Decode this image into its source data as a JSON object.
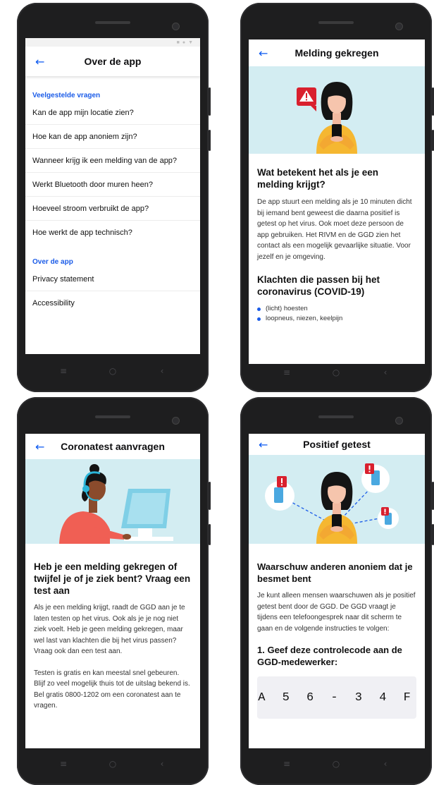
{
  "colors": {
    "accent": "#1b5ce8",
    "hero_bg": "#d3edf2",
    "alert_red": "#d9202e",
    "shirt_yellow": "#f5b731",
    "shirt_red": "#f05f54",
    "monitor_blue": "#7fcfe6"
  },
  "icons": {
    "back": "arrow-left-icon",
    "nav_menu": "menu-icon",
    "nav_home": "home-icon",
    "nav_back": "back-icon"
  },
  "nav": {
    "menu": "≡",
    "home": "○",
    "back": "‹"
  },
  "back_glyph": "←",
  "screen1": {
    "status_icons": [
      "■",
      "●",
      "▼"
    ],
    "title": "Over de app",
    "faq_label": "Veelgestelde vragen",
    "faq_items": [
      "Kan de app mijn locatie zien?",
      "Hoe kan de app anoniem zijn?",
      "Wanneer krijg ik een melding van de app?",
      "Werkt Bluetooth door muren heen?",
      "Hoeveel stroom verbruikt de app?",
      "Hoe werkt de app technisch?"
    ],
    "about_label": "Over de app",
    "about_items": [
      "Privacy statement",
      "Accessibility"
    ]
  },
  "screen2": {
    "title": "Melding gekregen",
    "heading1": "Wat betekent het als je een melding krijgt?",
    "body1": "De app stuurt een melding als je 10 minuten dicht bij iemand bent geweest die daarna positief is getest op het virus. Ook moet deze persoon de app gebruiken. Het RIVM en de GGD zien het contact als een mogelijk gevaarlijke situatie. Voor jezelf en je omgeving.",
    "heading2": "Klachten die passen bij het coronavirus (COVID-19)",
    "bullets": [
      "(licht) hoesten",
      "loopneus, niezen, keelpijn"
    ]
  },
  "screen3": {
    "title": "Coronatest aanvragen",
    "heading": "Heb je een melding gekregen of twijfel je of je ziek bent? Vraag een test aan",
    "body1": "Als je een melding krijgt, raadt de GGD aan je te laten testen op het virus. Ook als je je nog niet ziek voelt. Heb je geen melding gekregen, maar wel last van klachten die bij het virus passen? Vraag ook dan een test aan.",
    "body2": "Testen is gratis en kan meestal snel gebeuren. Blijf zo veel mogelijk thuis tot de uitslag bekend is. Bel gratis 0800-1202 om een coronatest aan te vragen."
  },
  "screen4": {
    "title": "Positief getest",
    "heading": "Waarschuw anderen anoniem dat je besmet bent",
    "body": "Je kunt alleen mensen waarschuwen als je positief getest bent door de GGD. De GGD vraagt je tijdens een telefoongesprek naar dit scherm te gaan en de volgende instructies te volgen:",
    "step_heading": "1. Geef deze controlecode aan de GGD-medewerker:",
    "code": "A56-34F"
  }
}
